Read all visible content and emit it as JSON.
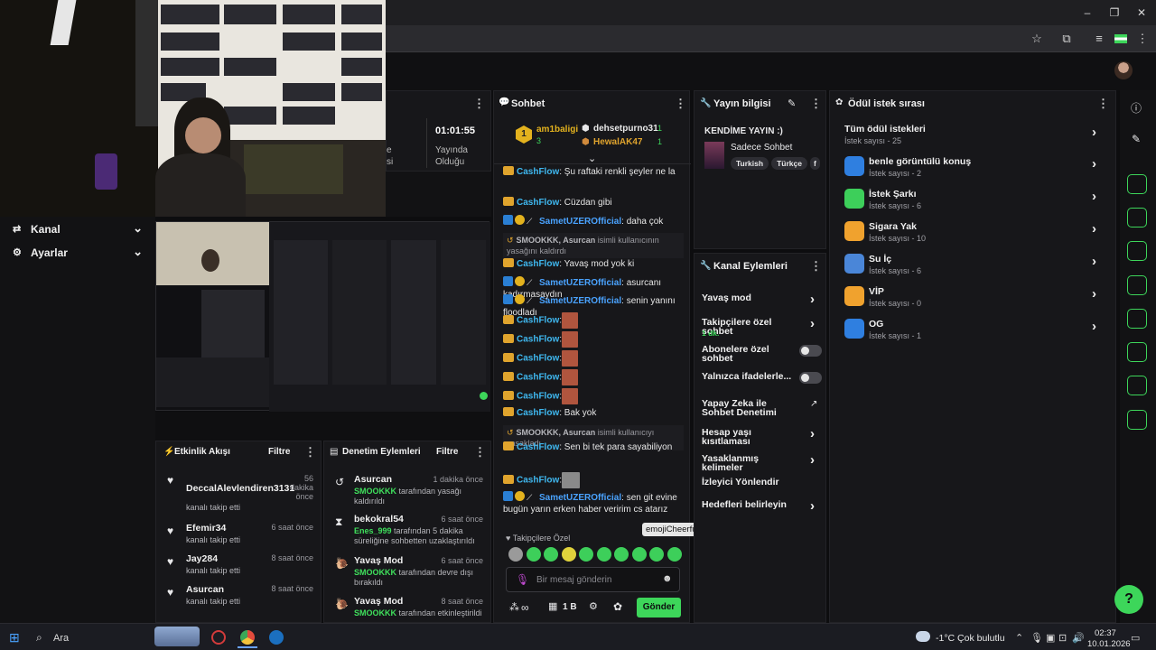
{
  "app": {
    "stream_info_title": "Yayın bilgisi",
    "stream_title": "KENDİME YAYIN :)",
    "category": "Sadece Sohbet",
    "tags": [
      "Turkish",
      "Türkçe",
      "f"
    ],
    "uptime": "01:01:55",
    "uptime_label_1": "Yayında",
    "uptime_label_2": "Olduğu",
    "partial_left_1": "e",
    "partial_left_2": "si"
  },
  "leftnav": {
    "items": [
      {
        "label": "Kanal"
      },
      {
        "label": "Ayarlar"
      }
    ]
  },
  "chat": {
    "title": "Sohbet",
    "top_users": [
      {
        "rank": "1",
        "name": "am1baligi",
        "count": "3"
      },
      {
        "name": "dehsetpurno31",
        "count": "1"
      },
      {
        "name": "HewalAK47",
        "count": "1"
      }
    ],
    "messages": [
      {
        "user": "CashFlow",
        "text": ": Şu raftaki renkli şeyler ne la"
      },
      {
        "user": "CashFlow",
        "text": ": Cüzdan gibi"
      },
      {
        "user": "SametUZEROfficial",
        "text": ": daha çok"
      },
      {
        "mod": true,
        "text_user": "SMOOKKK, Asurcan",
        "text": " isimli kullanıcının yasağını kaldırdı"
      },
      {
        "user": "CashFlow",
        "text": ": Yavaş mod yok ki"
      },
      {
        "user": "SametUZEROfficial",
        "text": ": asurcanı kadırmasaydın"
      },
      {
        "user": "SametUZEROfficial",
        "text": ": senin yanını floodladı"
      },
      {
        "user": "CashFlow",
        "text": ":"
      },
      {
        "user": "CashFlow",
        "text": ":"
      },
      {
        "user": "CashFlow",
        "text": ":"
      },
      {
        "user": "CashFlow",
        "text": ":"
      },
      {
        "user": "CashFlow",
        "text": ":"
      },
      {
        "user": "CashFlow",
        "text": ": Bak yok"
      },
      {
        "mod": true,
        "text_user": "SMOOKKK, Asurcan",
        "text": " isimli kullanıcıyı yasakladı"
      },
      {
        "user": "CashFlow",
        "text": ": Sen bi tek para sayabiliyon"
      },
      {
        "user": "CashFlow",
        "text": ":"
      },
      {
        "user": "SametUZEROfficial",
        "text": ": sen git evine bugün yarın erken haber veririm cs atarız"
      }
    ],
    "followers_only_label": "Takipçilere Özel",
    "tooltip": "emojiCheerful",
    "input_placeholder": "Bir mesaj gönderin",
    "points": "1 B",
    "send_label": "Gönder",
    "infinity": "∞"
  },
  "actions": {
    "title": "Kanal Eylemleri",
    "items": [
      {
        "label": "Yavaş mod",
        "type": "chevron"
      },
      {
        "label": "Takipçilere özel sohbet",
        "sub": "1 dk.",
        "type": "chevron"
      },
      {
        "label": "Abonelere özel sohbet",
        "type": "toggle"
      },
      {
        "label": "Yalnızca ifadelerle...",
        "type": "toggle"
      },
      {
        "label": "Yapay Zeka ile Sohbet Denetimi",
        "type": "link"
      },
      {
        "label": "Hesap yaşı kısıtlaması",
        "type": "chevron"
      },
      {
        "label": "Yasaklanmış kelimeler",
        "type": "chevron"
      },
      {
        "label": "İzleyici Yönlendir",
        "type": "none"
      },
      {
        "label": "Hedefleri belirleyin",
        "type": "chevron"
      }
    ]
  },
  "rewards": {
    "title": "Ödül istek sırası",
    "all_label": "Tüm ödül istekleri",
    "all_sub": "İstek sayısı - 25",
    "items": [
      {
        "title": "benle görüntülü konuş",
        "sub": "İstek sayısı - 2",
        "color": "#2f7fe0"
      },
      {
        "title": "İstek Şarkı",
        "sub": "İstek sayısı - 6",
        "color": "#3dcf5a"
      },
      {
        "title": "Sigara Yak",
        "sub": "İstek sayısı - 10",
        "color": "#f0a22e"
      },
      {
        "title": "Su İç",
        "sub": "İstek sayısı - 6",
        "color": "#4a86d8"
      },
      {
        "title": "VİP",
        "sub": "İstek sayısı - 0",
        "color": "#f0a22e"
      },
      {
        "title": "OG",
        "sub": "İstek sayısı - 1",
        "color": "#2f7fe0"
      }
    ]
  },
  "activity": {
    "title": "Etkinlik Akışı",
    "filter": "Filtre",
    "items": [
      {
        "name": "DeccalAlevlendiren3131",
        "sub": "kanalı takip etti",
        "time": "56 dakika önce"
      },
      {
        "name": "Efemir34",
        "sub": "kanalı takip etti",
        "time": "6 saat önce"
      },
      {
        "name": "Jay284",
        "sub": "kanalı takip etti",
        "time": "8 saat önce"
      },
      {
        "name": "Asurcan",
        "sub": "kanalı takip etti",
        "time": "8 saat önce"
      }
    ]
  },
  "moderation": {
    "title": "Denetim Eylemleri",
    "filter": "Filtre",
    "items": [
      {
        "name": "Asurcan",
        "actor": "SMOOKKK",
        "rest": " tarafından yasağı kaldırıldı",
        "time": "1 dakika önce"
      },
      {
        "name": "bekokral54",
        "actor": "Enes_999",
        "rest": " tarafından 5 dakika süreliğine sohbetten uzaklaştırıldı",
        "time": "6 saat önce"
      },
      {
        "name": "Yavaş Mod",
        "actor": "SMOOKKK",
        "rest": " tarafından devre dışı bırakıldı",
        "time": "6 saat önce"
      },
      {
        "name": "Yavaş Mod",
        "actor": "SMOOKKK",
        "rest": " tarafından etkinleştirildi",
        "time": "8 saat önce"
      }
    ]
  },
  "taskbar": {
    "search": "Ara",
    "weather": "-1°C  Çok bulutlu",
    "time": "02:37",
    "date": "10.01.2026"
  },
  "colors": {
    "accent": "#3dd65a",
    "background": "#0d0d0f",
    "panel": "#17171a"
  }
}
